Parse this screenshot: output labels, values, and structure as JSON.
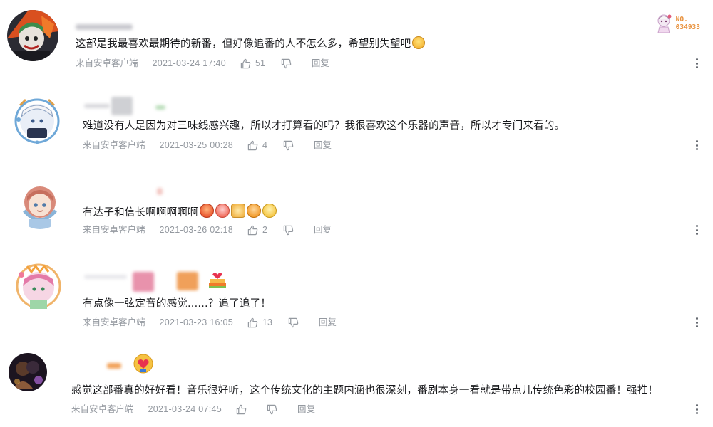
{
  "badge": {
    "label": "NO.",
    "number": "034933"
  },
  "comments": [
    {
      "content": "这部是我最喜欢最期待的新番，但好像追番的人不怎么多，希望别失望吧",
      "source": "来自安卓客户端",
      "time": "2021-03-24 17:40",
      "likes": "51",
      "reply": "回复"
    },
    {
      "content": "难道没有人是因为对三味线感兴趣，所以才打算看的吗？我很喜欢这个乐器的声音，所以才专门来看的。",
      "source": "来自安卓客户端",
      "time": "2021-03-25 00:28",
      "likes": "4",
      "reply": "回复"
    },
    {
      "content": "有达子和信长啊啊啊啊啊",
      "source": "来自安卓客户端",
      "time": "2021-03-26 02:18",
      "likes": "2",
      "reply": "回复"
    },
    {
      "content": "有点像一弦定音的感觉......？追了追了！",
      "source": "来自安卓客户端",
      "time": "2021-03-23 16:05",
      "likes": "13",
      "reply": "回复"
    },
    {
      "content": "感觉这部番真的好好看！音乐很好听，这个传统文化的主题内涵也很深刻，番剧本身一看就是带点儿传统色彩的校园番！强推！",
      "source": "来自安卓客户端",
      "time": "2021-03-24 07:45",
      "likes": "",
      "reply": "回复"
    }
  ],
  "colors": {
    "meta_text": "#9499a0",
    "divider": "#e3e5e7",
    "badge_orange": "#e8913c"
  },
  "icons": {
    "like": "thumbs-up-icon",
    "dislike": "thumbs-down-icon",
    "more": "more-vertical-icon"
  }
}
